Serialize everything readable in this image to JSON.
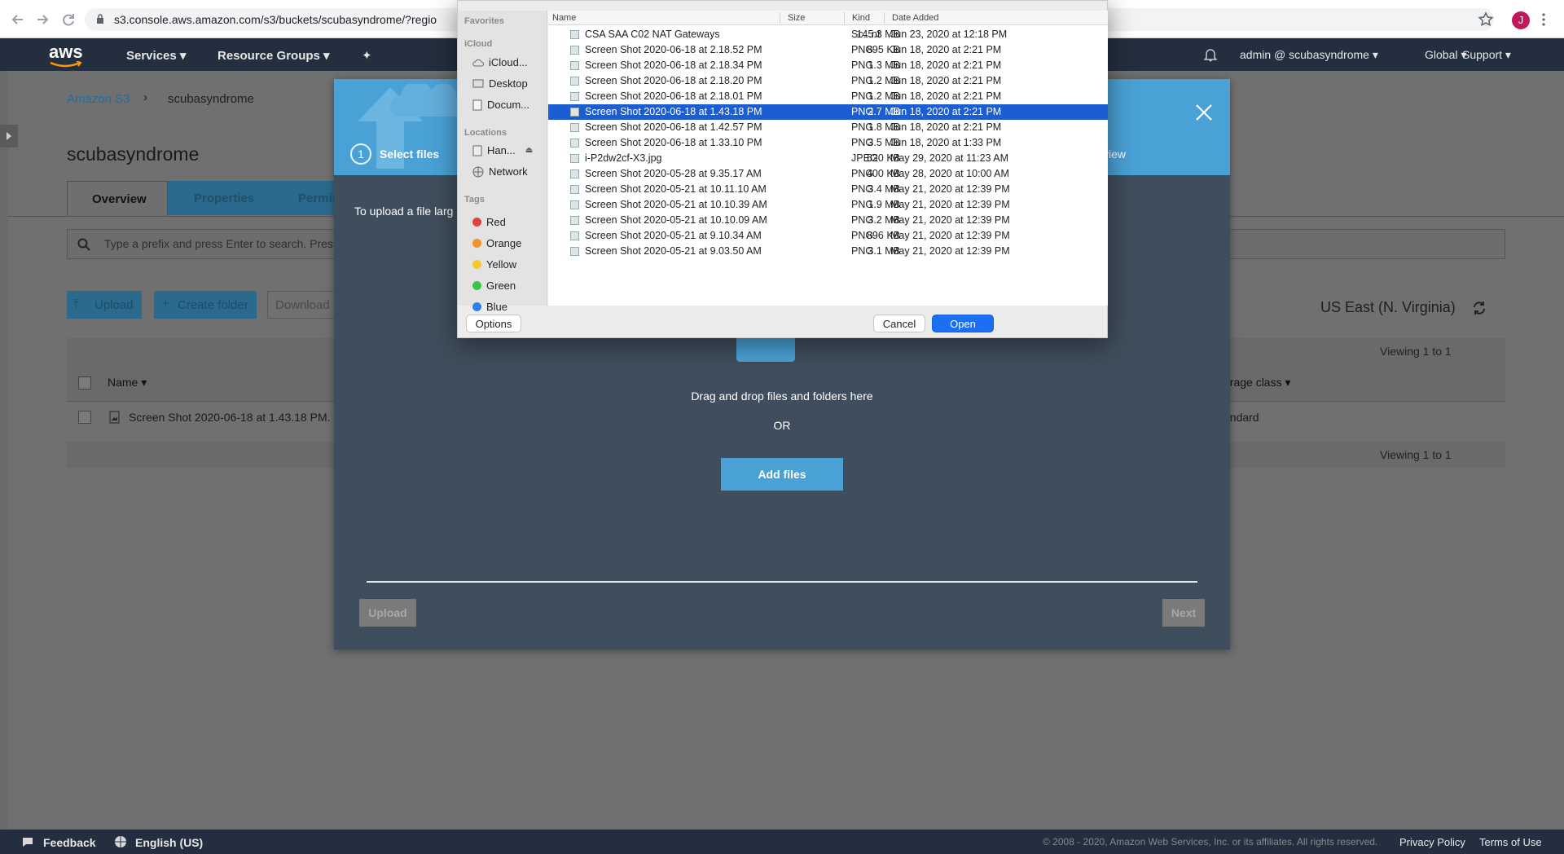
{
  "browser": {
    "url": "s3.console.aws.amazon.com/s3/buckets/scubasyndrome/?regio",
    "profile_initial": "J"
  },
  "aws_nav": {
    "logo": "aws",
    "services": "Services",
    "resource_groups": "Resource Groups",
    "account": "admin @ scubasyndrome",
    "region": "Global",
    "support": "Support"
  },
  "page": {
    "breadcrumb_root": "Amazon S3",
    "breadcrumb_sep": "›",
    "breadcrumb_bucket": "scubasyndrome",
    "bucket_title": "scubasyndrome",
    "tabs": [
      "Overview",
      "Properties",
      "Permis"
    ],
    "search_placeholder": "Type a prefix and press Enter to search. Press",
    "buttons": {
      "upload": "Upload",
      "create_folder": "Create folder",
      "download": "Download"
    },
    "region_label": "US East (N. Virginia)",
    "viewing_top": "Viewing 1 to 1",
    "viewing_bottom": "Viewing 1 to 1",
    "col_name": "Name",
    "col_storage": "orage class",
    "object_name": "Screen Shot 2020-06-18 at 1.43.18 PM.",
    "object_storage": "andard"
  },
  "modal": {
    "step_number": "1",
    "step_label": "Select files",
    "step_right": "view",
    "info_text": "To upload a file larg",
    "drag_text": "Drag and drop files and folders here",
    "or_text": "OR",
    "add_files": "Add files",
    "upload_btn": "Upload",
    "next_btn": "Next"
  },
  "finder": {
    "sidebar": {
      "favorites": "Favorites",
      "icloud_section": "iCloud",
      "icloud_item": "iCloud...",
      "desktop": "Desktop",
      "documents": "Docum...",
      "locations": "Locations",
      "drive": "Han...",
      "network": "Network",
      "tags": "Tags",
      "tag_items": [
        {
          "label": "Red",
          "color": "#e0443e"
        },
        {
          "label": "Orange",
          "color": "#f0922e"
        },
        {
          "label": "Yellow",
          "color": "#f4c82f"
        },
        {
          "label": "Green",
          "color": "#3cc44a"
        },
        {
          "label": "Blue",
          "color": "#2f7ff0"
        }
      ]
    },
    "columns": {
      "name": "Name",
      "size": "Size",
      "kind": "Kind",
      "date": "Date Added"
    },
    "files": [
      {
        "name": "CSA SAA C02 NAT Gateways",
        "size": "145.3 MB",
        "kind": "Sc...nt",
        "date": "Jun 23, 2020 at 12:18 PM"
      },
      {
        "name": "Screen Shot 2020-06-18 at 2.18.52 PM",
        "size": "895 KB",
        "kind": "PNG",
        "date": "Jun 18, 2020 at 2:21 PM"
      },
      {
        "name": "Screen Shot 2020-06-18 at 2.18.34 PM",
        "size": "1.3 MB",
        "kind": "PNG",
        "date": "Jun 18, 2020 at 2:21 PM"
      },
      {
        "name": "Screen Shot 2020-06-18 at 2.18.20 PM",
        "size": "1.2 MB",
        "kind": "PNG",
        "date": "Jun 18, 2020 at 2:21 PM"
      },
      {
        "name": "Screen Shot 2020-06-18 at 2.18.01 PM",
        "size": "1.2 MB",
        "kind": "PNG",
        "date": "Jun 18, 2020 at 2:21 PM"
      },
      {
        "name": "Screen Shot 2020-06-18 at 1.43.18 PM",
        "size": "2.7 MB",
        "kind": "PNG",
        "date": "Jun 18, 2020 at 2:21 PM"
      },
      {
        "name": "Screen Shot 2020-06-18 at 1.42.57 PM",
        "size": "1.8 MB",
        "kind": "PNG",
        "date": "Jun 18, 2020 at 2:21 PM"
      },
      {
        "name": "Screen Shot 2020-06-18 at 1.33.10 PM",
        "size": "3.5 MB",
        "kind": "PNG",
        "date": "Jun 18, 2020 at 1:33 PM"
      },
      {
        "name": "i-P2dw2cf-X3.jpg",
        "size": "620 KB",
        "kind": "JPEG",
        "date": "May 29, 2020 at 11:23 AM"
      },
      {
        "name": "Screen Shot 2020-05-28 at 9.35.17 AM",
        "size": "400 KB",
        "kind": "PNG",
        "date": "May 28, 2020 at 10:00 AM"
      },
      {
        "name": "Screen Shot 2020-05-21 at 10.11.10 AM",
        "size": "3.4 MB",
        "kind": "PNG",
        "date": "May 21, 2020 at 12:39 PM"
      },
      {
        "name": "Screen Shot 2020-05-21 at 10.10.39 AM",
        "size": "1.9 MB",
        "kind": "PNG",
        "date": "May 21, 2020 at 12:39 PM"
      },
      {
        "name": "Screen Shot 2020-05-21 at 10.10.09 AM",
        "size": "3.2 MB",
        "kind": "PNG",
        "date": "May 21, 2020 at 12:39 PM"
      },
      {
        "name": "Screen Shot 2020-05-21 at 9.10.34 AM",
        "size": "896 KB",
        "kind": "PNG",
        "date": "May 21, 2020 at 12:39 PM"
      },
      {
        "name": "Screen Shot 2020-05-21 at 9.03.50 AM",
        "size": "3.1 MB",
        "kind": "PNG",
        "date": "May 21, 2020 at 12:39 PM"
      }
    ],
    "selected_file": "Screen Shot 2020-06-18 at 1.43.18 PM",
    "options": "Options",
    "cancel": "Cancel",
    "open": "Open"
  },
  "footer": {
    "feedback": "Feedback",
    "language": "English (US)",
    "copyright": "© 2008 - 2020, Amazon Web Services, Inc. or its affiliates. All rights reserved.",
    "privacy": "Privacy Policy",
    "terms": "Terms of Use"
  },
  "colors": {
    "aws_nav": "#232f3e",
    "modal_header": "#4aa1d6",
    "selection": "#1b5dd3",
    "open_button": "#1a6ff2"
  }
}
